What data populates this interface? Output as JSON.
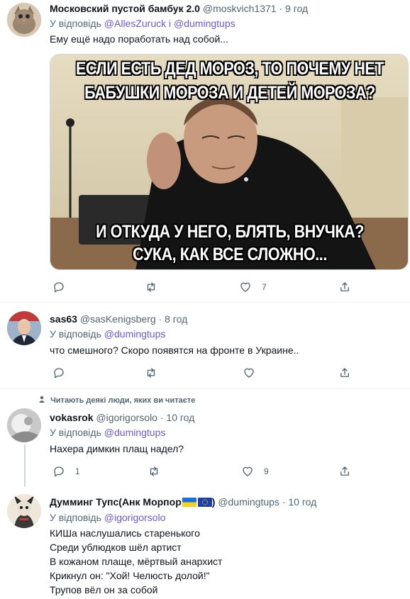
{
  "tweets": [
    {
      "name": "Московский пустой бамбук 2.0",
      "handle": "@moskvich1371",
      "time": "9 год",
      "reply_prefix": "У відповідь",
      "reply_mentions": "@AllesZuruck і @dumingtups",
      "text": "Ему ещё надо поработать над собой...",
      "meme_lines": [
        "ЕСЛИ ЕСТЬ ДЕД МОРОЗ, ТО ПОЧЕМУ НЕТ",
        "БАБУШКИ МОРОЗА И ДЕТЕЙ МОРОЗА?",
        "И ОТКУДА У НЕГО, БЛЯТЬ, ВНУЧКА?",
        "СУКА, КАК ВСЕ СЛОЖНО..."
      ],
      "replies": "",
      "retweets": "",
      "likes": "7"
    },
    {
      "name": "sas63",
      "handle": "@sasKenigsberg",
      "time": "8 год",
      "reply_prefix": "У відповідь",
      "reply_mentions": "@dumingtups",
      "text": "что смешного? Скоро появятся на фронте в Украине..",
      "replies": "",
      "retweets": "",
      "likes": ""
    },
    {
      "social_context": "Читають деякі люди, яких ви читаєте",
      "name": "vokasrok",
      "handle": "@igorigorsolo",
      "time": "10 год",
      "reply_prefix": "У відповідь",
      "reply_mentions": "@dumingtups",
      "text": "Нахера димкин плащ надел?",
      "replies": "1",
      "retweets": "",
      "likes": "9"
    },
    {
      "name": "Думминг Тупс(Анк Морпор",
      "name_suffix": ")",
      "handle": "@dumingtups",
      "time": "10 год",
      "reply_prefix": "У відповідь",
      "reply_mentions": "@igorigorsolo",
      "lines": [
        "КИШа наслушались старенького",
        "Среди ублюдков шёл артист",
        "В кожаном плаще, мёртвый анархист",
        "Крикнул он: \"Хой! Челюсть долой!\"",
        "Трупов вёл он за собой"
      ]
    }
  ],
  "separator": "·",
  "colors": {
    "text": "#0f1419",
    "secondary": "#536471",
    "mention": "#6a5acd",
    "border": "#eff3f4"
  },
  "icons": [
    "reply-icon",
    "retweet-icon",
    "like-icon",
    "share-icon",
    "person-icon",
    "flag-ua-icon",
    "flag-eu-icon"
  ]
}
